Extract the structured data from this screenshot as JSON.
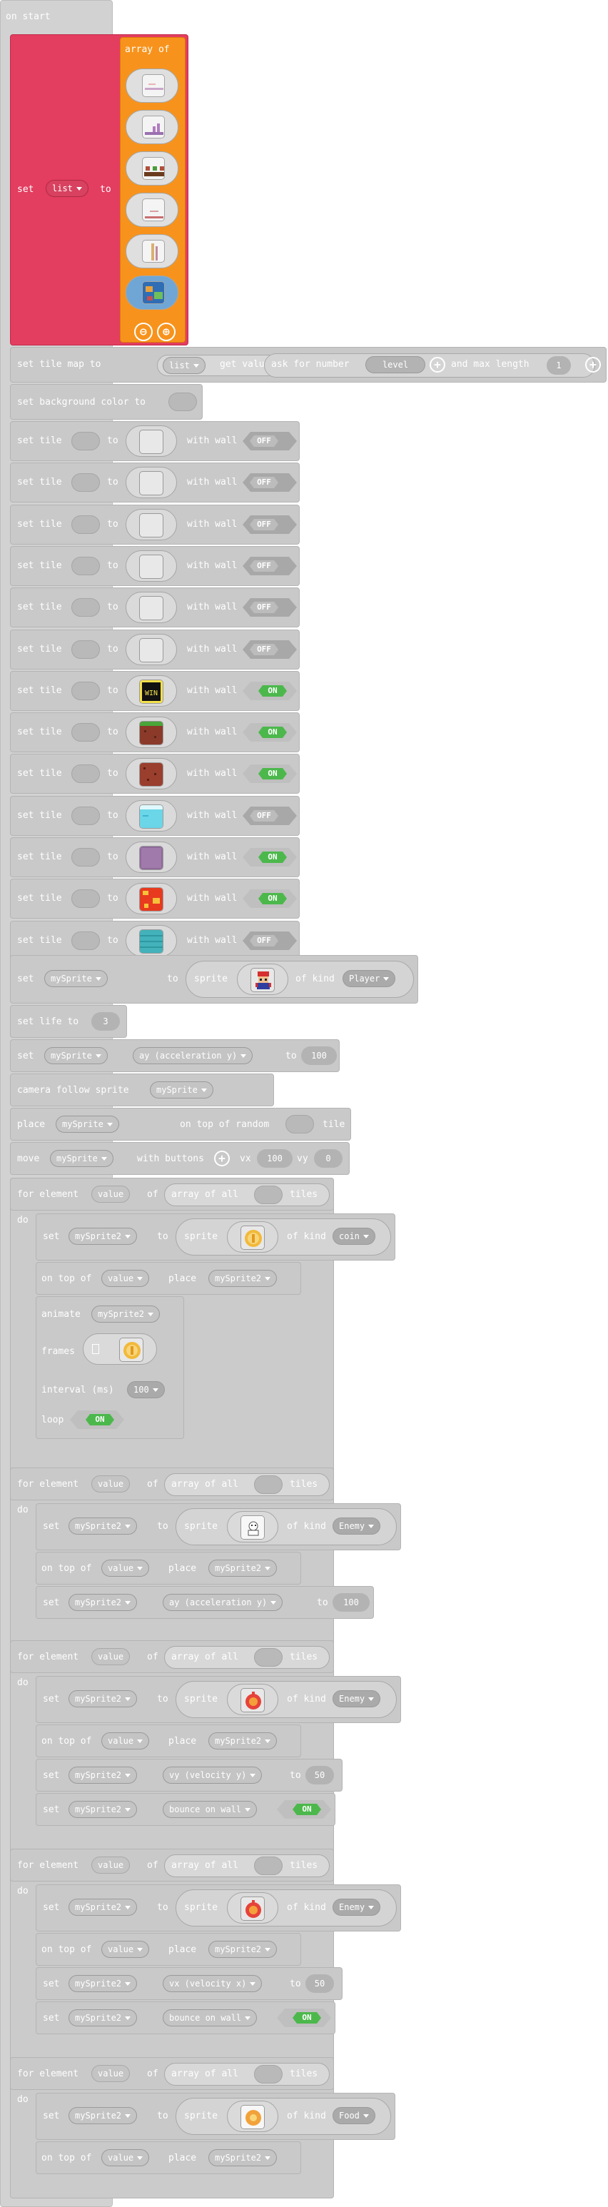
{
  "hat": {
    "label": "on start"
  },
  "set_list": {
    "set": "set",
    "var": "list",
    "to": "to",
    "array_label": "array of",
    "minus": "⊖",
    "plus": "⊕"
  },
  "tilemap": {
    "set": "set tile map to",
    "var": "list",
    "get": "get value at",
    "ask": "ask for number",
    "prompt": "level",
    "maxlen": "and max length",
    "maxval": "1"
  },
  "bg": {
    "label": "set background color to"
  },
  "tile_rows": [
    {
      "set": "set tile",
      "to": "to",
      "wall": "with wall",
      "state": "OFF",
      "img": "empty"
    },
    {
      "set": "set tile",
      "to": "to",
      "wall": "with wall",
      "state": "OFF",
      "img": "empty"
    },
    {
      "set": "set tile",
      "to": "to",
      "wall": "with wall",
      "state": "OFF",
      "img": "empty"
    },
    {
      "set": "set tile",
      "to": "to",
      "wall": "with wall",
      "state": "OFF",
      "img": "empty"
    },
    {
      "set": "set tile",
      "to": "to",
      "wall": "with wall",
      "state": "OFF",
      "img": "empty"
    },
    {
      "set": "set tile",
      "to": "to",
      "wall": "with wall",
      "state": "OFF",
      "img": "empty"
    },
    {
      "set": "set tile",
      "to": "to",
      "wall": "with wall",
      "state": "ON",
      "img": "win"
    },
    {
      "set": "set tile",
      "to": "to",
      "wall": "with wall",
      "state": "ON",
      "img": "grass"
    },
    {
      "set": "set tile",
      "to": "to",
      "wall": "with wall",
      "state": "ON",
      "img": "brick"
    },
    {
      "set": "set tile",
      "to": "to",
      "wall": "with wall",
      "state": "OFF",
      "img": "water"
    },
    {
      "set": "set tile",
      "to": "to",
      "wall": "with wall",
      "state": "ON",
      "img": "purple"
    },
    {
      "set": "set tile",
      "to": "to",
      "wall": "with wall",
      "state": "ON",
      "img": "lava"
    },
    {
      "set": "set tile",
      "to": "to",
      "wall": "with wall",
      "state": "OFF",
      "img": "teal"
    }
  ],
  "sprite": {
    "set": "set",
    "var": "mySprite",
    "to": "to",
    "sprite": "sprite",
    "kind_label": "of kind",
    "kind": "Player"
  },
  "life": {
    "label": "set life to",
    "value": "3"
  },
  "accel": {
    "set": "set",
    "var": "mySprite",
    "prop": "ay (acceleration y)",
    "to": "to",
    "value": "100"
  },
  "camera": {
    "label": "camera follow sprite",
    "var": "mySprite"
  },
  "place": {
    "label": "place",
    "var": "mySprite",
    "mid": "on top of random",
    "tile": "tile"
  },
  "move": {
    "label": "move",
    "var": "mySprite",
    "with": "with buttons",
    "vx": "vx",
    "vxv": "100",
    "vy": "vy",
    "vyv": "0"
  },
  "loops": [
    {
      "for": "for element",
      "value": "value",
      "of": "of",
      "arr": "array of all",
      "tiles": "tiles",
      "do": "do",
      "s_set": "set",
      "s_var": "mySprite2",
      "s_to": "to",
      "s_sprite": "sprite",
      "s_kind_label": "of kind",
      "s_kind": "coin",
      "p_on": "on top of",
      "p_value": "value",
      "p_place": "place",
      "p_var": "mySprite2",
      "anim": "animate",
      "anim_var": "mySprite2",
      "frames": "frames",
      "interval": "interval (ms)",
      "interval_v": "100",
      "loop": "loop",
      "loop_state": "ON"
    },
    {
      "for": "for element",
      "value": "value",
      "of": "of",
      "arr": "array of all",
      "tiles": "tiles",
      "do": "do",
      "s_set": "set",
      "s_var": "mySprite2",
      "s_to": "to",
      "s_sprite": "sprite",
      "s_kind_label": "of kind",
      "s_kind": "Enemy",
      "p_on": "on top of",
      "p_value": "value",
      "p_place": "place",
      "p_var": "mySprite2",
      "r1_set": "set",
      "r1_var": "mySprite2",
      "r1_prop": "ay (acceleration y)",
      "r1_to": "to",
      "r1_val": "100"
    },
    {
      "for": "for element",
      "value": "value",
      "of": "of",
      "arr": "array of all",
      "tiles": "tiles",
      "do": "do",
      "s_set": "set",
      "s_var": "mySprite2",
      "s_to": "to",
      "s_sprite": "sprite",
      "s_kind_label": "of kind",
      "s_kind": "Enemy",
      "p_on": "on top of",
      "p_value": "value",
      "p_place": "place",
      "p_var": "mySprite2",
      "r1_set": "set",
      "r1_var": "mySprite2",
      "r1_prop": "vy (velocity y)",
      "r1_to": "to",
      "r1_val": "50",
      "r2_set": "set",
      "r2_var": "mySprite2",
      "r2_prop": "bounce on wall",
      "r2_state": "ON"
    },
    {
      "for": "for element",
      "value": "value",
      "of": "of",
      "arr": "array of all",
      "tiles": "tiles",
      "do": "do",
      "s_set": "set",
      "s_var": "mySprite2",
      "s_to": "to",
      "s_sprite": "sprite",
      "s_kind_label": "of kind",
      "s_kind": "Enemy",
      "p_on": "on top of",
      "p_value": "value",
      "p_place": "place",
      "p_var": "mySprite2",
      "r1_set": "set",
      "r1_var": "mySprite2",
      "r1_prop": "vx (velocity x)",
      "r1_to": "to",
      "r1_val": "50",
      "r2_set": "set",
      "r2_var": "mySprite2",
      "r2_prop": "bounce on wall",
      "r2_state": "ON"
    },
    {
      "for": "for element",
      "value": "value",
      "of": "of",
      "arr": "array of all",
      "tiles": "tiles",
      "do": "do",
      "s_set": "set",
      "s_var": "mySprite2",
      "s_to": "to",
      "s_sprite": "sprite",
      "s_kind_label": "of kind",
      "s_kind": "Food",
      "p_on": "on top of",
      "p_value": "value",
      "p_place": "place",
      "p_var": "mySprite2"
    }
  ]
}
